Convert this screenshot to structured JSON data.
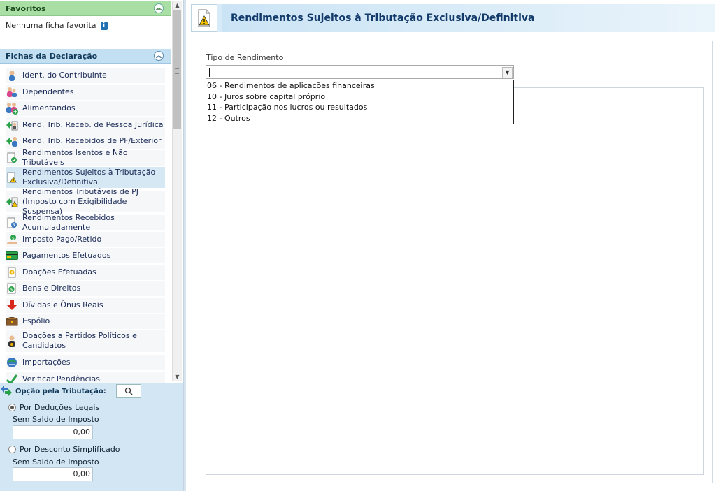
{
  "favoritos": {
    "title": "Favoritos",
    "empty_text": "Nenhuma ficha favorita"
  },
  "fichas": {
    "title": "Fichas da Declaração",
    "items": [
      {
        "label": "Ident. do Contribuinte",
        "icon": "person-icon"
      },
      {
        "label": "Dependentes",
        "icon": "dependents-icon"
      },
      {
        "label": "Alimentandos",
        "icon": "people-add-icon"
      },
      {
        "label": "Rend. Trib. Receb. de Pessoa Jurídica",
        "icon": "arrow-person-icon"
      },
      {
        "label": "Rend. Trib. Recebidos de PF/Exterior",
        "icon": "arrow-person-icon"
      },
      {
        "label": "Rendimentos Isentos e Não Tributáveis",
        "icon": "document-check-icon"
      },
      {
        "label": "Rendimentos Sujeitos à Tributação Exclusiva/Definitiva",
        "icon": "document-warning-icon"
      },
      {
        "label": "Rendimentos Tributáveis de PJ (Imposto com Exigibilidade Suspensa)",
        "icon": "arrow-warning-icon"
      },
      {
        "label": "Rendimentos Recebidos Acumuladamente",
        "icon": "document-clock-icon"
      },
      {
        "label": "Imposto Pago/Retido",
        "icon": "money-hand-icon"
      },
      {
        "label": "Pagamentos Efetuados",
        "icon": "credit-card-icon"
      },
      {
        "label": "Doações Efetuadas",
        "icon": "donation-icon"
      },
      {
        "label": "Bens e Direitos",
        "icon": "money-bag-icon"
      },
      {
        "label": "Dívidas e Ônus Reais",
        "icon": "debt-arrow-icon"
      },
      {
        "label": "Espólio",
        "icon": "chest-icon"
      },
      {
        "label": "Doações a Partidos Políticos e Candidatos",
        "icon": "candidate-icon"
      },
      {
        "label": "Importações",
        "icon": "import-icon"
      },
      {
        "label": "Verificar Pendências",
        "icon": "checkmark-icon"
      }
    ]
  },
  "opcao": {
    "label": "Opção pela Tributação:",
    "deducoes": {
      "label": "Por Deduções Legais",
      "sub": "Sem Saldo de Imposto",
      "value": "0,00"
    },
    "simplificado": {
      "label": "Por Desconto Simplificado",
      "sub": "Sem Saldo de Imposto",
      "value": "0,00"
    }
  },
  "page": {
    "title": "Rendimentos Sujeitos à Tributação Exclusiva/Definitiva"
  },
  "form": {
    "tipo_label": "Tipo de Rendimento",
    "options": [
      "06 - Rendimentos de aplicações financeiras",
      "10 - Juros sobre capital próprio",
      "11 - Participação nos lucros ou resultados",
      "12 - Outros"
    ]
  },
  "colors": {
    "accent": "#c3dff2",
    "favoritos": "#a9dfa5",
    "title": "#123a6a"
  }
}
